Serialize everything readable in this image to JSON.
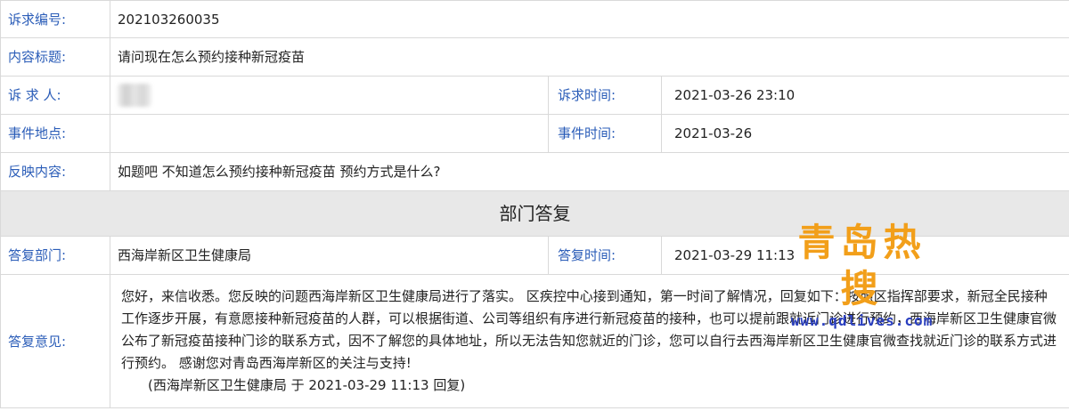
{
  "rows": {
    "complaint_no": {
      "label": "诉求编号:",
      "value": "202103260035"
    },
    "title": {
      "label": "内容标题:",
      "value": "请问现在怎么预约接种新冠疫苗"
    },
    "requester": {
      "label": "诉 求 人:",
      "time_label": "诉求时间:",
      "time_value": "2021-03-26 23:10"
    },
    "location": {
      "label": "事件地点:",
      "value": "",
      "time_label": "事件时间:",
      "time_value": "2021-03-26"
    },
    "content": {
      "label": "反映内容:",
      "value": "如题吧 不知道怎么预约接种新冠疫苗 预约方式是什么?"
    }
  },
  "section_header": "部门答复",
  "reply": {
    "dept_label": "答复部门:",
    "dept_value": "西海岸新区卫生健康局",
    "time_label": "答复时间:",
    "time_value": "2021-03-29 11:13",
    "opinion_label": "答复意见:",
    "opinion_text": "您好，来信收悉。您反映的问题西海岸新区卫生健康局进行了落实。 区疾控中心接到通知，第一时间了解情况，回复如下：按照区指挥部要求，新冠全民接种工作逐步开展，有意愿接种新冠疫苗的人群，可以根据街道、公司等组织有序进行新冠疫苗的接种，也可以提前跟就近门诊进行预约，西海岸新区卫生健康官微公布了新冠疫苗接种门诊的联系方式，因不了解您的具体地址，所以无法告知您就近的门诊，您可以自行去西海岸新区卫生健康官微查找就近门诊的联系方式进行预约。 感谢您对青岛西海岸新区的关注与支持!",
    "signature": "(西海岸新区卫生健康局 于 2021-03-29 11:13 回复)"
  },
  "watermark": {
    "title": "青岛热搜",
    "url": "www.qdlives.com"
  },
  "colors": {
    "label": "#2b5db8",
    "section_bg": "#e8e8e8",
    "watermark_title": "#f29f1a",
    "watermark_url": "#2a3fc0"
  }
}
